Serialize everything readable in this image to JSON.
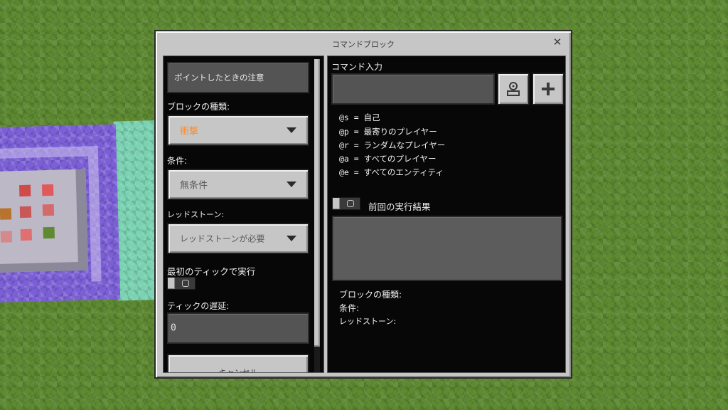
{
  "dialog": {
    "title": "コマンドブロック",
    "close_glyph": "✕"
  },
  "left": {
    "hover_note": "ポイントしたときの注意",
    "block_type_label": "ブロックの種類:",
    "block_type_value": "衝撃",
    "block_type_color": "#ff8c2a",
    "condition_label": "条件:",
    "condition_value": "無条件",
    "redstone_label": "レッドストーン:",
    "redstone_value": "レッドストーンが必要",
    "first_tick_label": "最初のティックで実行",
    "tick_delay_label": "ティックの遅延:",
    "tick_delay_value": "0",
    "cancel_label": "キャンセル"
  },
  "right": {
    "command_input_label": "コマンド入力",
    "command_value": "",
    "help": [
      {
        "code": "@s",
        "eq": " = ",
        "text": "自己"
      },
      {
        "code": "@p",
        "eq": " = ",
        "text": "最寄りのプレイヤー"
      },
      {
        "code": "@r",
        "eq": " = ",
        "text": "ランダムなプレイヤー"
      },
      {
        "code": "@a",
        "eq": " = ",
        "text": "すべてのプレイヤー"
      },
      {
        "code": "@e",
        "eq": " = ",
        "text": "すべてのエンティティ"
      }
    ],
    "previous_output_label": "前回の実行結果",
    "info_block_type": "ブロックの種類:",
    "info_condition": "条件:",
    "info_redstone": "レッドストーン:"
  }
}
